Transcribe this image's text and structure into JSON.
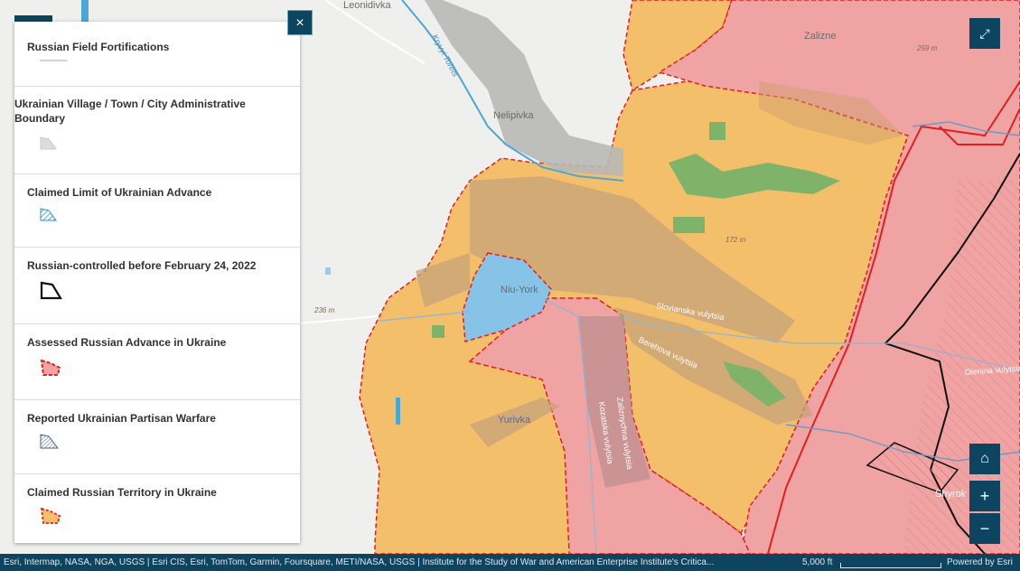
{
  "map": {
    "place_labels": {
      "leonidivka": "Leonidivka",
      "zalizne": "Zalizne",
      "nelipivka": "Nelipivka",
      "niu_york": "Niu-York",
      "yurivka": "Yurivka",
      "shyrok": "Shyrok"
    },
    "water_labels": {
      "kryvyi_torets": "Kryvyi Torets"
    },
    "street_labels": {
      "slovianska": "Slovianska vulytsia",
      "berehova": "Berehova vulytsia",
      "kozatska": "Kozatska vulytsia",
      "zaliznychna": "Zaliznychna vulytsia",
      "olenina": "Olenina vulytsia"
    },
    "elevations": {
      "e259": "259 m",
      "e172": "172 m",
      "e236": "236 m"
    },
    "colors": {
      "claimed_russian": "#f4bf6a",
      "assessed_advance": "#f0a3a3",
      "ukr_limit_hatch": "#4aa7d6",
      "niu_york_fill": "#86c3e6",
      "red_border": "#e02020",
      "ui_dark": "#0d4560"
    }
  },
  "legend": {
    "close_glyph": "×",
    "items": [
      {
        "title": "Russian Field Fortifications",
        "swatch": "gray-line"
      },
      {
        "title": "Ukrainian Village / Town / City Administrative Boundary",
        "swatch": "gray-polygon"
      },
      {
        "title": "Claimed Limit of Ukrainian Advance",
        "swatch": "blue-hatch"
      },
      {
        "title": "Russian-controlled before February 24, 2022",
        "swatch": "black-outline"
      },
      {
        "title": "Assessed Russian Advance in Ukraine",
        "swatch": "red-dashed"
      },
      {
        "title": "Reported Ukrainian Partisan Warfare",
        "swatch": "navy-hatch"
      },
      {
        "title": "Claimed Russian Territory in Ukraine",
        "swatch": "orange-dashed"
      }
    ]
  },
  "controls": {
    "fullscreen_glyph": "⤢",
    "home_glyph": "⌂",
    "zoom_in_glyph": "+",
    "zoom_out_glyph": "−"
  },
  "attribution": {
    "text": "Esri, Intermap, NASA, NGA, USGS | Esri CIS, Esri, TomTom, Garmin, Foursquare, METI/NASA, USGS | Institute for the Study of War and American Enterprise Institute's Critica...",
    "scale": "5,000 ft",
    "powered": "Powered by Esri"
  }
}
